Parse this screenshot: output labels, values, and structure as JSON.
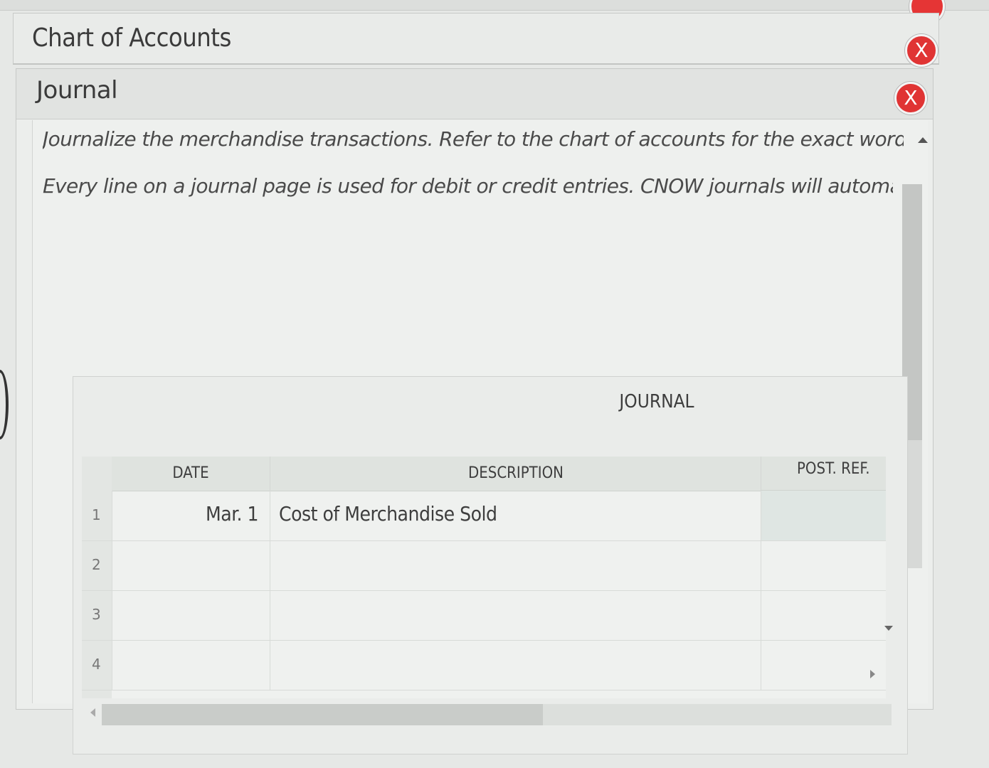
{
  "accounts_panel": {
    "title": "Chart of Accounts",
    "close_label": "X"
  },
  "journal_panel": {
    "title": "Journal",
    "close_label": "X",
    "instructions": [
      "Journalize the merchandise transactions. Refer to the chart of accounts for the exact wording of t",
      "Every line on a journal page is used for debit or credit entries. CNOW journals will automatically i"
    ]
  },
  "journal_table": {
    "caption": "JOURNAL",
    "headers": {
      "date": "DATE",
      "description": "DESCRIPTION",
      "post_ref": "POST. REF."
    },
    "rows": [
      {
        "num": "1",
        "date": "Mar. 1",
        "description": "Cost of Merchandise Sold",
        "post_ref": ""
      },
      {
        "num": "2",
        "date": "",
        "description": "",
        "post_ref": ""
      },
      {
        "num": "3",
        "date": "",
        "description": "",
        "post_ref": ""
      },
      {
        "num": "4",
        "date": "",
        "description": "",
        "post_ref": ""
      }
    ]
  },
  "icons": [
    "close-icon",
    "scroll-up-icon",
    "scroll-down-icon",
    "scroll-left-icon",
    "scroll-right-icon"
  ],
  "colors": {
    "close_button": "#e03434",
    "background": "#e6e8e6"
  }
}
